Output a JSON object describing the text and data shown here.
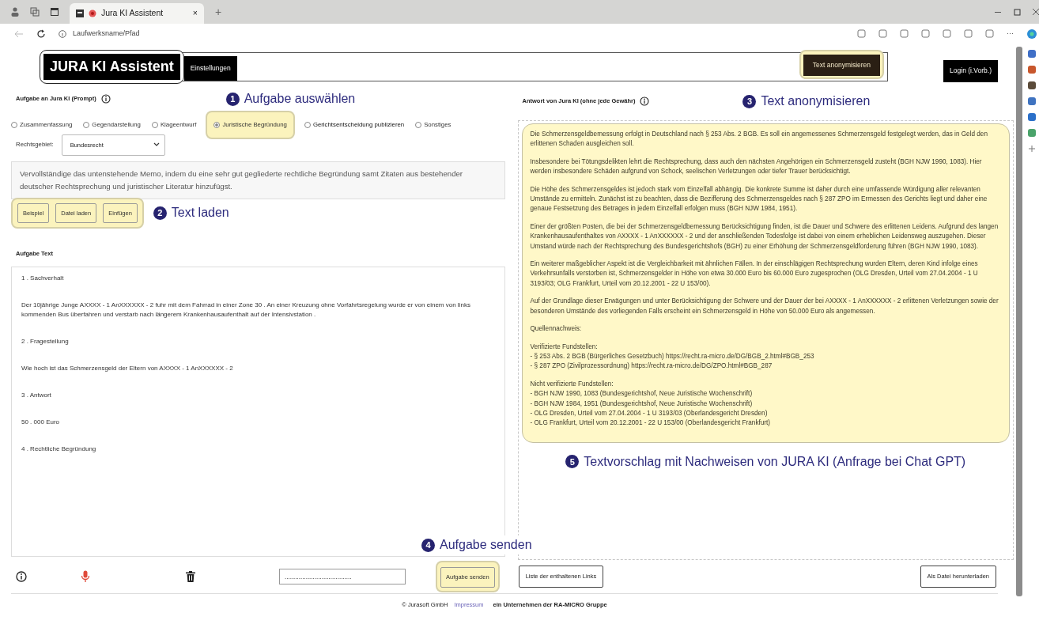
{
  "browser": {
    "tab_title": "Jura KI Assistent",
    "tab_close": "×",
    "new_tab": "+",
    "address": "Laufwerksname/Pfad",
    "more": "···"
  },
  "header": {
    "logo": "JURA KI Assistent",
    "settings_button": "Einstellungen",
    "anonymize_button": {
      "label": "Text anonymisieren",
      "highlighted": true
    },
    "login_button": "Login (i.Vorb.)"
  },
  "prompt": {
    "label": "Aufgabe an Jura KI (Prompt)",
    "annotation": {
      "number": "1",
      "text": "Aufgabe auswählen"
    },
    "options": [
      {
        "label": "Zusammenfassung",
        "selected": false,
        "highlighted": false
      },
      {
        "label": "Gegendarstellung",
        "selected": false,
        "highlighted": false
      },
      {
        "label": "Klageentwurf",
        "selected": false,
        "highlighted": false
      },
      {
        "label": "Juristische Begründung",
        "selected": true,
        "highlighted": true
      },
      {
        "label": "Gerichtsentscheidung  publizieren",
        "selected": false,
        "highlighted": false
      },
      {
        "label": "Sonstiges",
        "selected": false,
        "highlighted": false
      }
    ],
    "field_label": "Rechtsgebiet:",
    "field_value": "Bundesrecht",
    "text": "Vervollständige das untenstehende Memo, indem du eine sehr gut gegliederte rechtliche Begründung samt Zitaten aus bestehender deutscher Rechtsprechung und juristischer Literatur hinzufügst."
  },
  "load": {
    "buttons": [
      "Beispiel",
      "Datei laden",
      "Einfügen"
    ],
    "highlighted": true,
    "annotation": {
      "number": "2",
      "text": "Text laden"
    }
  },
  "task_text": {
    "label": "Aufgabe Text",
    "paragraphs": [
      "1 . Sachverhalt",
      "Der 10jährige Junge AXXXX - 1 AnXXXXXX - 2 fuhr mit dem Fahrrad in einer Zone 30 . An einer Kreuzung ohne Vorfahrtsregelung wurde er von einem von links kommenden Bus überfahren und verstarb nach längerem Krankenhausaufenthalt auf der Intensivstation .",
      "2 . Fragestellung",
      "Wie hoch ist das Schmerzensgeld der Eltern von AXXXX - 1 AnXXXXXX - 2",
      "3 . Antwort",
      "50 . 000 Euro",
      "4 . Rechtliche Begründung"
    ]
  },
  "answer": {
    "label": "Antwort von Jura KI (ohne jede Gewähr)",
    "annotation": {
      "number": "3",
      "text": "Text anonymisieren"
    },
    "highlighted": true,
    "blocks": [
      [
        "Die Schmerzensgeldbemessung erfolgt in Deutschland nach § 253 Abs. 2 BGB. Es soll ein angemessenes Schmerzensgeld festgelegt werden, das in Geld den erlittenen Schaden ausgleichen soll."
      ],
      [
        "Insbesondere bei Tötungsdelikten lehrt die Rechtsprechung, dass auch den nächsten Angehörigen ein Schmerzensgeld zusteht (BGH NJW 1990, 1083). Hier werden insbesondere Schäden aufgrund von Schock, seelischen Verletzungen oder tiefer Trauer berücksichtigt."
      ],
      [
        "Die Höhe des Schmerzensgeldes ist jedoch stark vom Einzelfall abhängig. Die konkrete Summe ist daher durch eine umfassende Würdigung aller relevanten Umstände zu ermitteln. Zunächst ist zu beachten, dass die Bezifferung des Schmerzensgeldes nach § 287 ZPO im Ermessen des Gerichts liegt und daher eine genaue Festsetzung des Betrages in jedem Einzelfall erfolgen muss (BGH NJW 1984, 1951)."
      ],
      [
        "Einer der größten Posten, die bei der Schmerzensgeldbemessung Berücksichtigung finden, ist die Dauer und Schwere des erlittenen Leidens. Aufgrund des langen Krankenhausaufenthaltes von AXXXX - 1 AnXXXXXX - 2 und der anschließenden Todesfolge ist dabei von einem erheblichen Leidensweg auszugehen. Dieser Umstand würde nach der Rechtsprechung des Bundesgerichtshofs (BGH) zu einer Erhöhung der Schmerzensgeldforderung führen (BGH NJW 1990, 1083)."
      ],
      [
        "Ein weiterer maßgeblicher Aspekt ist die Vergleichbarkeit mit ähnlichen Fällen. In der einschlägigen Rechtsprechung wurden Eltern, deren Kind infolge eines Verkehrsunfalls verstorben ist, Schmerzensgelder in Höhe von etwa 30.000 Euro bis 60.000 Euro zugesprochen (OLG Dresden, Urteil vom 27.04.2004 - 1 U 3193/03; OLG Frankfurt, Urteil vom 20.12.2001 - 22 U 153/00)."
      ],
      [
        "Auf der Grundlage dieser Erwägungen und unter Berücksichtigung der Schwere und der Dauer der bei AXXXX - 1 AnXXXXXX - 2 erlittenen Verletzungen sowie der besonderen Umstände des vorliegenden Falls erscheint ein Schmerzensgeld in Höhe von 50.000 Euro als angemessen."
      ],
      [
        "Quellennachweis:"
      ],
      [
        "Verifizierte Fundstellen:",
        "- § 253 Abs. 2 BGB (Bürgerliches Gesetzbuch) https://recht.ra-micro.de/DG/BGB_2.html#BGB_253",
        "- § 287 ZPO (Zivilprozessordnung) https://recht.ra-micro.de/DG/ZPO.html#BGB_287"
      ],
      [
        "Nicht verifizierte Fundstellen:",
        "- BGH NJW 1990, 1083 (Bundesgerichtshof, Neue Juristische Wochenschrift)",
        "- BGH NJW 1984, 1951 (Bundesgerichtshof, Neue Juristische Wochenschrift)",
        "- OLG Dresden, Urteil vom 27.04.2004 - 1 U 3193/03 (Oberlandesgericht Dresden)",
        "- OLG Frankfurt, Urteil vom 20.12.2001 - 22 U 153/00 (Oberlandesgericht Frankfurt)"
      ]
    ],
    "bottom_annotation": {
      "number": "5",
      "text": "Textvorschlag mit Nachweisen von JURA KI (Anfrage bei Chat GPT)"
    }
  },
  "actions": {
    "key_field": "......................................",
    "send_button": {
      "label": "Aufgabe senden",
      "highlighted": true
    },
    "send_annotation": {
      "number": "4",
      "text": "Aufgabe senden"
    },
    "links_button": "Liste der enthaltenen Links",
    "download_button": "Als Datei herunterladen"
  },
  "footer": {
    "copyright": "© Jurasoft GmbH",
    "imprint_link": "Impressum",
    "company": "ein Unternehmen der RA-MICRO Gruppe"
  }
}
